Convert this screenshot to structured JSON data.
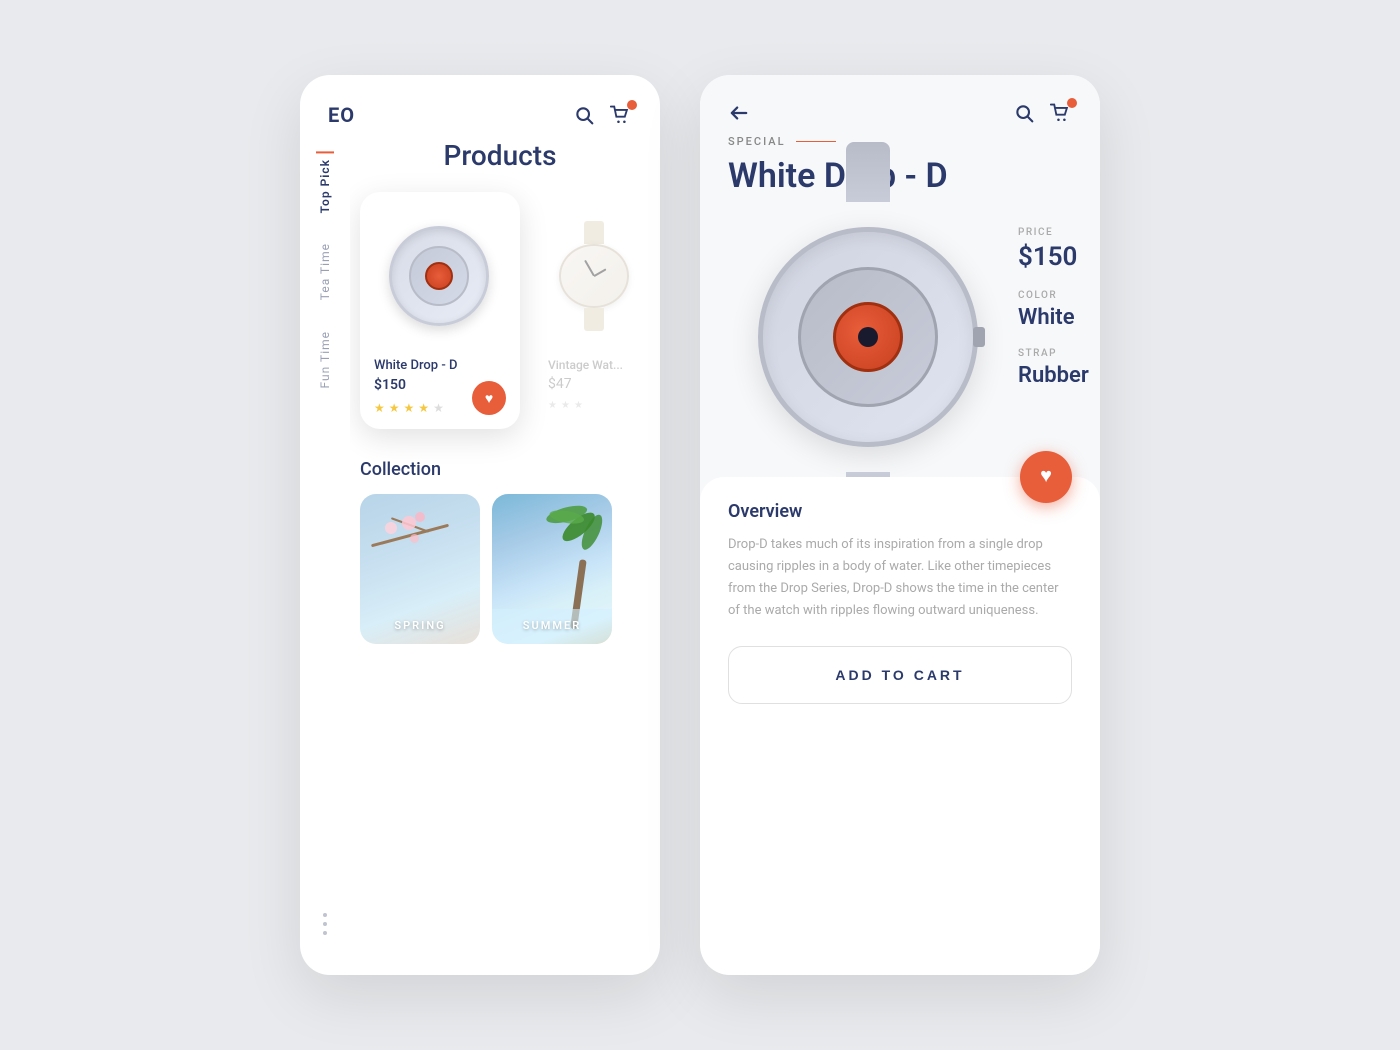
{
  "app": {
    "logo": "EO",
    "accent_color": "#e85d3a",
    "primary_color": "#2b3a6b"
  },
  "left_panel": {
    "header": {
      "logo": "EO",
      "search_label": "search",
      "cart_label": "cart"
    },
    "sidebar": {
      "items": [
        {
          "label": "Top Pick",
          "active": true
        },
        {
          "label": "Tea Time",
          "active": false
        },
        {
          "label": "Fun Time",
          "active": false
        }
      ]
    },
    "products_section": {
      "title": "Products",
      "items": [
        {
          "name": "White Drop - D",
          "price": "$150",
          "rating": 4,
          "max_rating": 5
        },
        {
          "name": "Vintage Watch",
          "price": "$47",
          "rating": 3,
          "max_rating": 5,
          "faded": true
        }
      ]
    },
    "collection_section": {
      "title": "Collection",
      "items": [
        {
          "label": "SPRING"
        },
        {
          "label": "SUMMER"
        }
      ]
    }
  },
  "right_panel": {
    "header": {
      "back_label": "back",
      "search_label": "search",
      "cart_label": "cart"
    },
    "product": {
      "special_label": "SPECIAL",
      "title": "White Drop - D",
      "price_label": "PRICE",
      "price": "$150",
      "color_label": "COLOR",
      "color": "White",
      "strap_label": "STRAP",
      "strap": "Rubber",
      "overview_title": "Overview",
      "overview_text": "Drop-D takes much of its inspiration from a single drop causing ripples in a body of water. Like other timepieces from the Drop Series, Drop-D shows the time in the center of the watch with ripples flowing outward uniqueness.",
      "add_to_cart_label": "ADD TO CART"
    }
  }
}
